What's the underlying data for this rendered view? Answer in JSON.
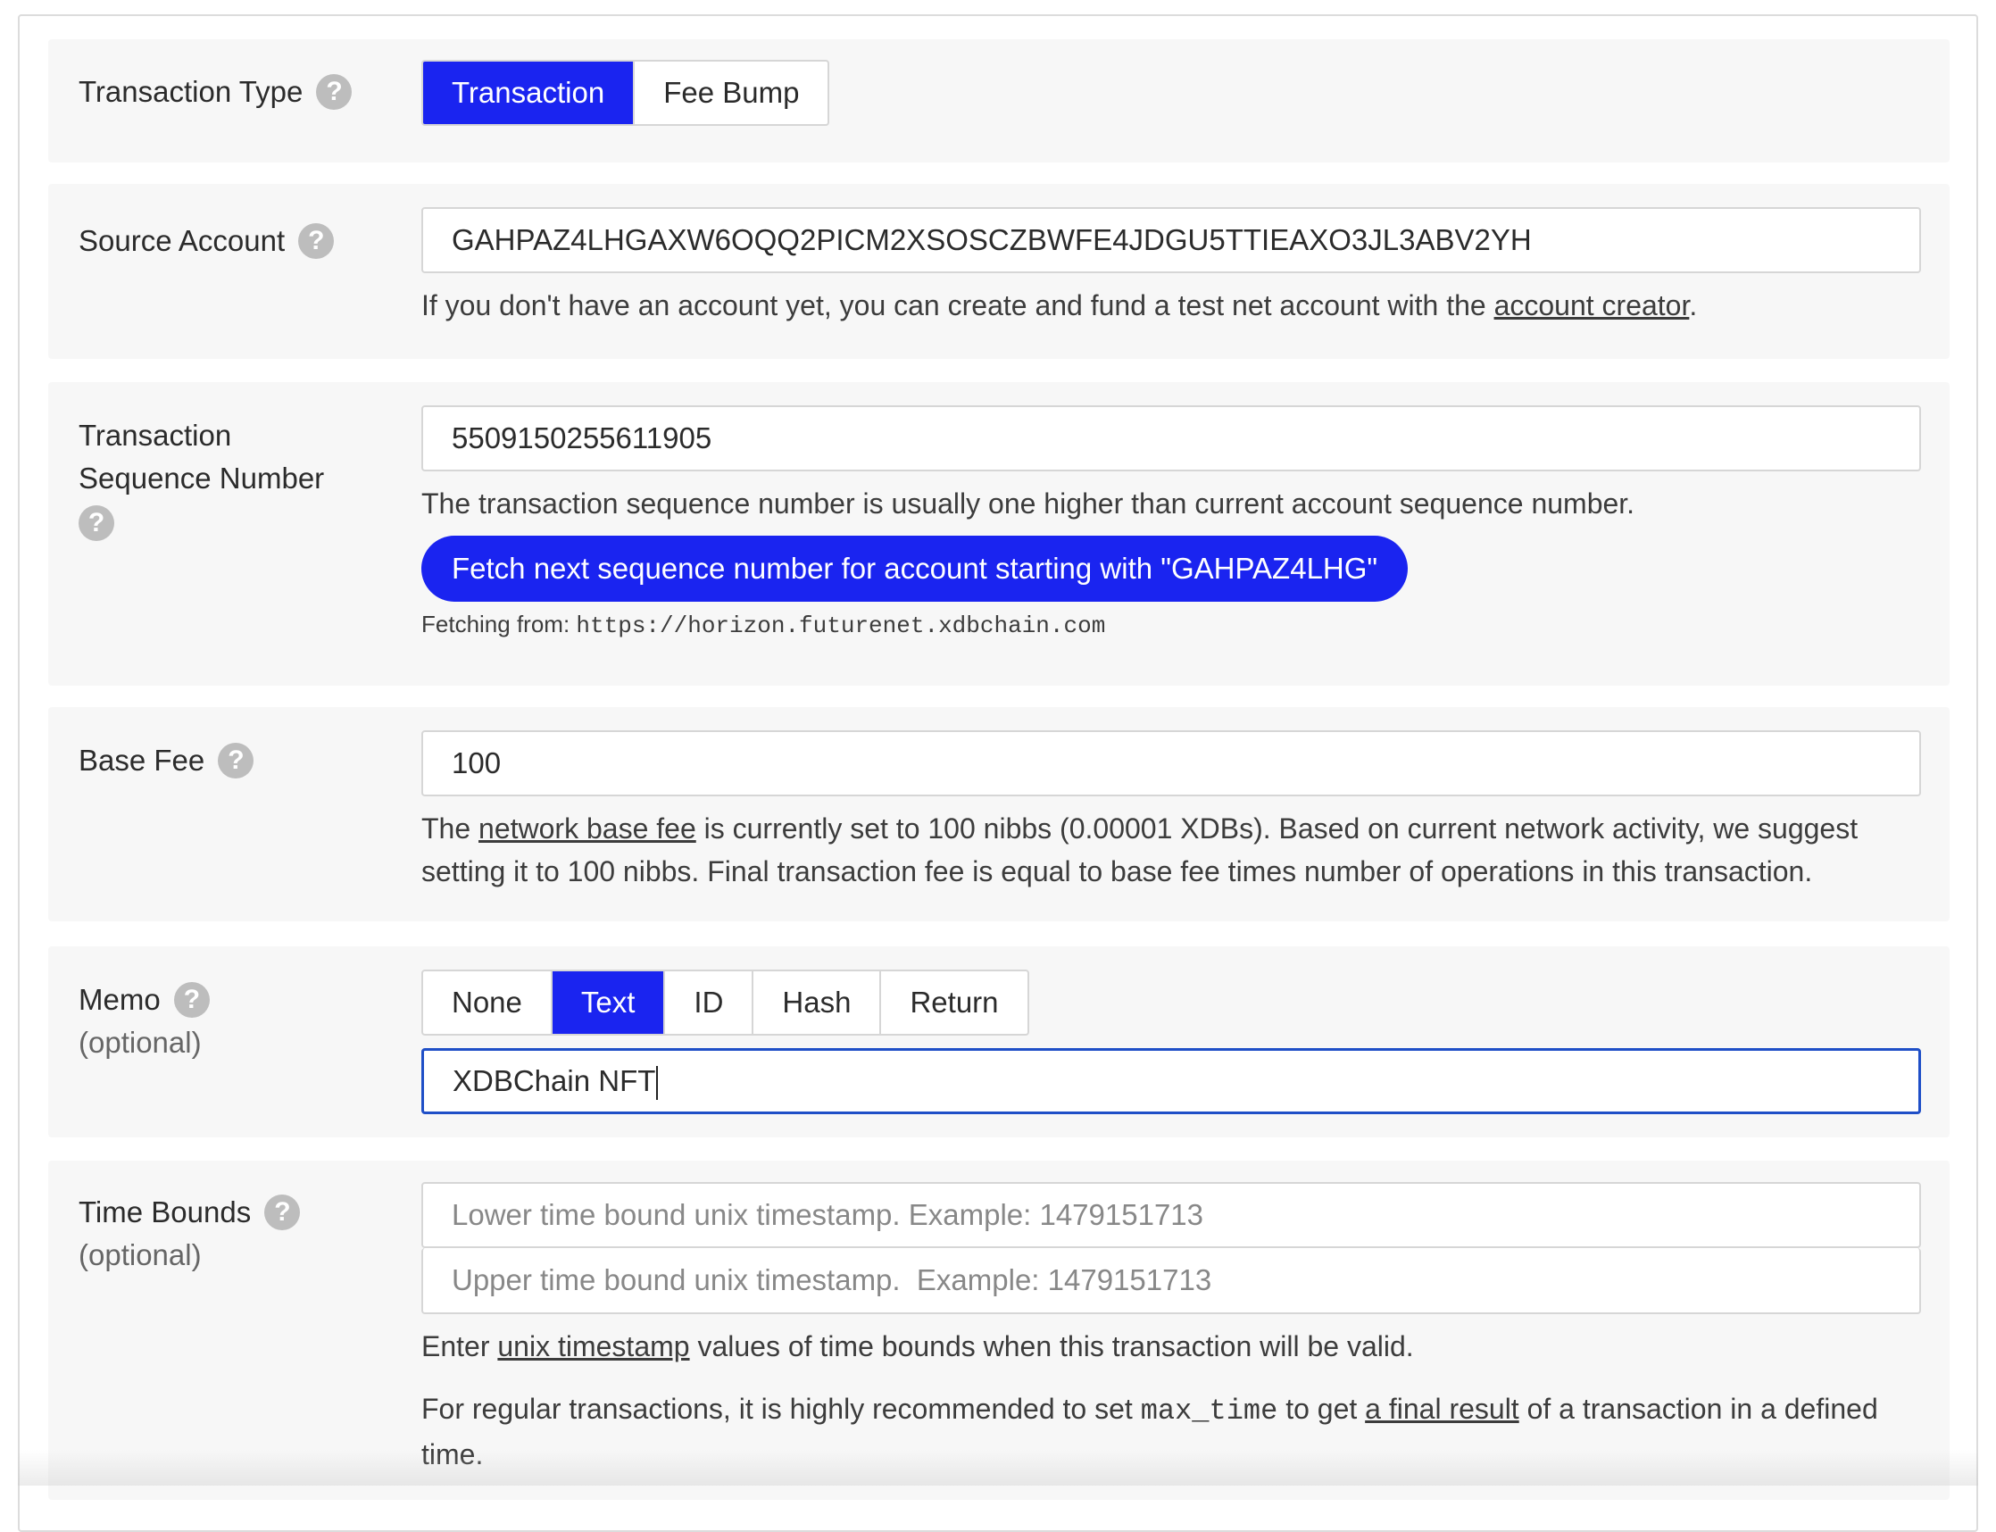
{
  "transaction_type": {
    "label": "Transaction Type",
    "options": [
      "Transaction",
      "Fee Bump"
    ],
    "selected": "Transaction"
  },
  "source_account": {
    "label": "Source Account",
    "value": "GAHPAZ4LHGAXW6OQQ2PICM2XSOSCZBWFE4JDGU5TTIEAXO3JL3ABV2YH",
    "help_prefix": "If you don't have an account yet, you can create and fund a test net account with the ",
    "help_link": "account creator",
    "help_suffix": "."
  },
  "sequence_number": {
    "label_line1": "Transaction",
    "label_line2": "Sequence Number",
    "value": "5509150255611905",
    "help": "The transaction sequence number is usually one higher than current account sequence number.",
    "fetch_button": "Fetch next sequence number for account starting with \"GAHPAZ4LHG\"",
    "fetching_label": "Fetching from: ",
    "fetching_url": "https://horizon.futurenet.xdbchain.com"
  },
  "base_fee": {
    "label": "Base Fee",
    "value": "100",
    "help_prefix": "The ",
    "help_link": "network base fee",
    "help_line1_suffix": " is currently set to 100 nibbs (0.00001 XDBs). Based on current network activity, we suggest",
    "help_line2": "setting it to 100 nibbs. Final transaction fee is equal to base fee times number of operations in this transaction."
  },
  "memo": {
    "label": "Memo",
    "optional": "(optional)",
    "options": [
      "None",
      "Text",
      "ID",
      "Hash",
      "Return"
    ],
    "selected": "Text",
    "value": "XDBChain NFT"
  },
  "time_bounds": {
    "label": "Time Bounds",
    "optional": "(optional)",
    "lower_placeholder": "Lower time bound unix timestamp. Example: 1479151713",
    "upper_placeholder": "Upper time bound unix timestamp.  Example: 1479151713",
    "help1_prefix": "Enter ",
    "help1_link": "unix timestamp",
    "help1_suffix": " values of time bounds when this transaction will be valid.",
    "help2_prefix": "For regular transactions, it is highly recommended to set ",
    "help2_code": "max_time",
    "help2_mid": " to get ",
    "help2_link": "a final result",
    "help2_suffix": " of a transaction in a defined",
    "help2_line2": "time."
  },
  "colors": {
    "accent": "#1a24f0",
    "focus_border": "#1f4fc7",
    "row_background": "#f7f7f7",
    "help_icon": "#bdbdbd"
  },
  "icons": {
    "help": "question-mark-circle"
  }
}
